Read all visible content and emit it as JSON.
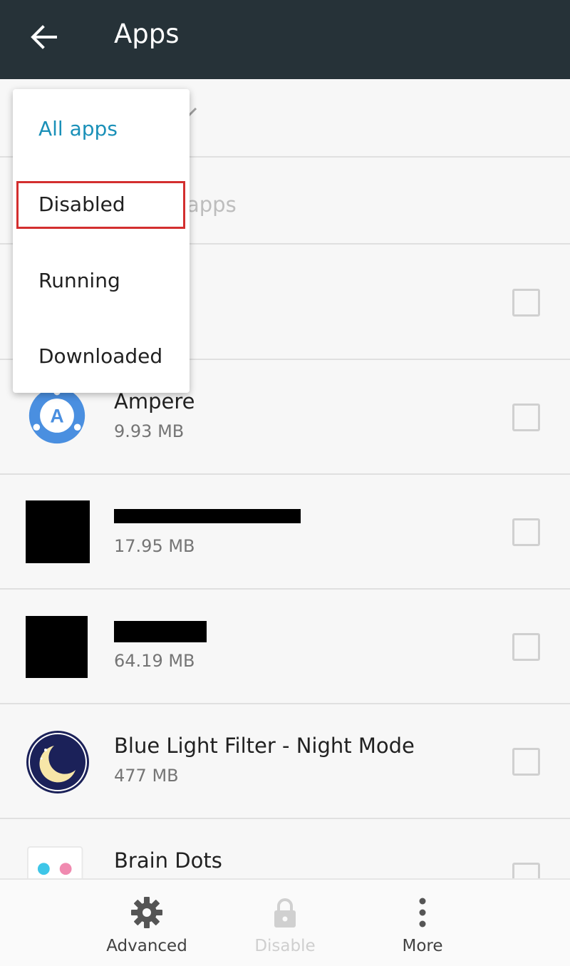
{
  "appbar": {
    "title": "Apps"
  },
  "hint": {
    "text": "apps"
  },
  "menu": {
    "items": [
      {
        "label": "All apps",
        "selected": true
      },
      {
        "label": "Disabled",
        "highlighted": true
      },
      {
        "label": "Running"
      },
      {
        "label": "Downloaded"
      }
    ]
  },
  "apps": [
    {
      "name": "",
      "size": "",
      "checked": false
    },
    {
      "name": "Ampere",
      "size": "9.93 MB",
      "icon": "ampere-icon",
      "checked": false
    },
    {
      "name": "",
      "size": "17.95 MB",
      "icon": "redacted-icon",
      "checked": false
    },
    {
      "name": "",
      "size": "64.19 MB",
      "icon": "redacted-icon",
      "checked": false
    },
    {
      "name": "Blue Light Filter - Night Mode",
      "size": "477 MB",
      "icon": "moon-icon",
      "checked": false
    },
    {
      "name": "Brain Dots",
      "size": "",
      "icon": "brain-dots-icon",
      "checked": false
    }
  ],
  "toolbar": {
    "advanced_label": "Advanced",
    "disable_label": "Disable",
    "more_label": "More"
  },
  "colors": {
    "appbar": "#263238",
    "accent": "#1a90b8",
    "highlight": "#d32f2f",
    "ampere": "#4a8fe0",
    "night": "#1b2159"
  }
}
